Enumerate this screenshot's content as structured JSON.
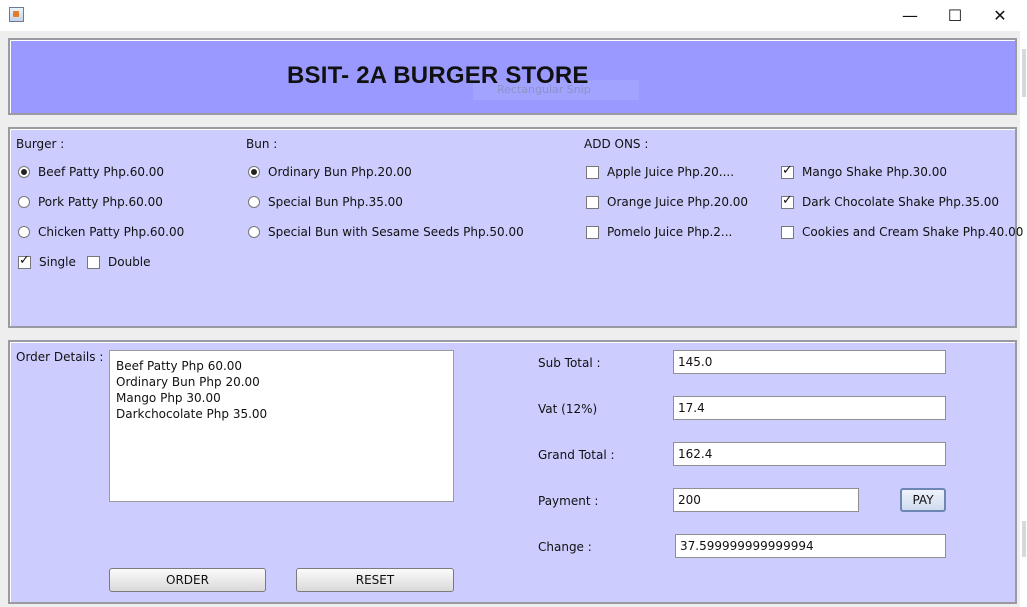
{
  "window": {
    "minimize_glyph": "—",
    "maximize_glyph": "☐",
    "close_glyph": "✕",
    "icon": "java-cup-icon"
  },
  "header": {
    "title": "BSIT- 2A BURGER STORE",
    "ghost_label": "Rectangular Snip"
  },
  "menu": {
    "burger_label": "Burger :",
    "burgers": [
      {
        "label": "Beef Patty Php.60.00",
        "selected": true
      },
      {
        "label": "Pork Patty Php.60.00",
        "selected": false
      },
      {
        "label": "Chicken Patty Php.60.00",
        "selected": false
      }
    ],
    "size_options": [
      {
        "label": "Single",
        "checked": true
      },
      {
        "label": "Double",
        "checked": false
      }
    ],
    "bun_label": "Bun :",
    "buns": [
      {
        "label": "Ordinary Bun Php.20.00",
        "selected": true
      },
      {
        "label": "Special Bun Php.35.00",
        "selected": false
      },
      {
        "label": "Special Bun with Sesame Seeds Php.50.00",
        "selected": false
      }
    ],
    "addons_label": "ADD ONS :",
    "addons_left": [
      {
        "label": "Apple Juice Php.20....",
        "checked": false
      },
      {
        "label": "Orange Juice Php.20.00",
        "checked": false
      },
      {
        "label": "Pomelo Juice Php.2...",
        "checked": false
      }
    ],
    "addons_right": [
      {
        "label": "Mango Shake Php.30.00",
        "checked": true
      },
      {
        "label": "Dark Chocolate Shake Php.35.00",
        "checked": true
      },
      {
        "label": "Cookies and Cream Shake Php.40.00",
        "checked": false
      }
    ]
  },
  "order": {
    "details_label": "Order Details :",
    "lines": [
      "Beef Patty Php 60.00",
      "Ordinary Bun Php 20.00",
      "Mango Php 30.00",
      "Darkchocolate Php 35.00"
    ],
    "order_button": "ORDER",
    "reset_button": "RESET"
  },
  "totals": {
    "subtotal_label": "Sub Total :",
    "subtotal_value": "145.0",
    "vat_label": "Vat (12%)",
    "vat_value": "17.4",
    "grand_label": "Grand Total :",
    "grand_value": "162.4",
    "payment_label": "Payment :",
    "payment_value": "200",
    "pay_button": "PAY",
    "change_label": "Change :",
    "change_value": "37.599999999999994"
  },
  "colors": {
    "header_bg": "#9999ff",
    "panel_bg": "#ccccff",
    "window_bg": "#eeeeee"
  }
}
